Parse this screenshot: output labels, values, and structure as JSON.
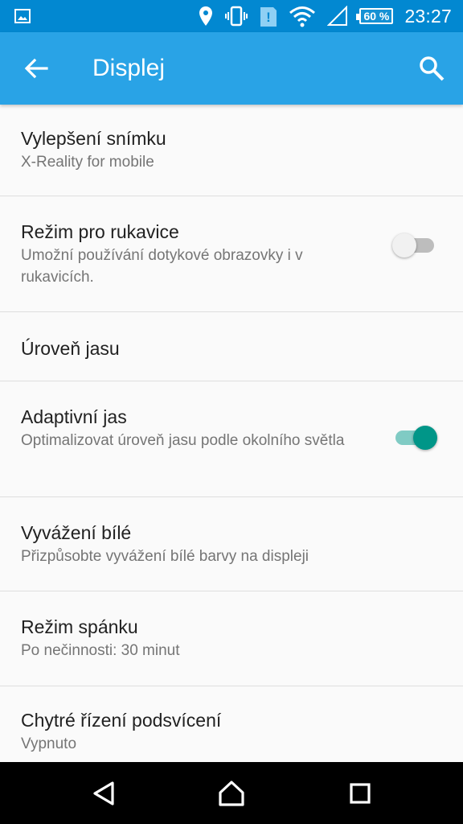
{
  "status_bar": {
    "battery_percent": "60 %",
    "time": "23:27",
    "icons": [
      "image-icon",
      "location-icon",
      "vibrate-icon",
      "alert-icon",
      "wifi-icon",
      "signal-icon",
      "battery-icon"
    ]
  },
  "app_bar": {
    "title": "Displej",
    "back_icon": "arrow-back-icon",
    "search_icon": "search-icon",
    "color": "#29a3e6"
  },
  "settings": [
    {
      "title": "Vylepšení snímku",
      "summary": "X-Reality for mobile"
    },
    {
      "title": "Režim pro rukavice",
      "summary": "Umožní používání dotykové obrazovky i v rukavicích.",
      "toggle": false
    },
    {
      "title": "Úroveň jasu",
      "summary": ""
    },
    {
      "title": "Adaptivní jas",
      "summary": "Optimalizovat úroveň jasu podle okolního světla",
      "toggle": true
    },
    {
      "title": "Vyvážení bílé",
      "summary": "Přizpůsobte vyvážení bílé barvy na displeji"
    },
    {
      "title": "Režim spánku",
      "summary": "Po nečinnosti: 30 minut"
    },
    {
      "title": "Chytré řízení podsvícení",
      "summary": "Vypnuto"
    }
  ],
  "navigation": {
    "buttons": [
      "back-triangle-icon",
      "home-icon",
      "recents-icon"
    ]
  },
  "colors": {
    "status_bar": "#0288d1",
    "toggle_on": "#009688",
    "toggle_track_on": "#80cbc4"
  }
}
